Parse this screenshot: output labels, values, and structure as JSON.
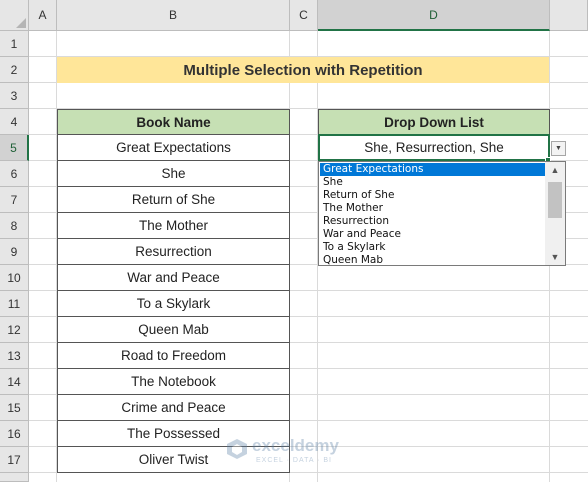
{
  "columns": [
    "A",
    "B",
    "C",
    "D"
  ],
  "rows": [
    "1",
    "2",
    "3",
    "4",
    "5",
    "6",
    "7",
    "8",
    "9",
    "10",
    "11",
    "12",
    "13",
    "14",
    "15",
    "16",
    "17"
  ],
  "active_cell": {
    "column": "D",
    "row": "5"
  },
  "title": "Multiple Selection with Repetition",
  "table": {
    "header": "Book Name",
    "books": [
      "Great Expectations",
      "She",
      "Return of She",
      "The Mother",
      "Resurrection",
      "War and Peace",
      "To a Skylark",
      "Queen Mab",
      "Road to Freedom",
      "The Notebook",
      "Crime and Peace",
      "The Possessed",
      "Oliver Twist"
    ]
  },
  "dropdown": {
    "header": "Drop Down List",
    "value": "She, Resurrection, She",
    "options": [
      "Great Expectations",
      "She",
      "Return of She",
      "The Mother",
      "Resurrection",
      "War and Peace",
      "To a Skylark",
      "Queen Mab"
    ],
    "selected_index": 0
  },
  "watermark": {
    "name": "exceldemy",
    "tagline": "EXCEL · DATA · BI"
  },
  "colors": {
    "title_fill": "#ffe699",
    "header_fill": "#c6e0b4",
    "selection": "#0078d7",
    "excel_green": "#217346"
  }
}
